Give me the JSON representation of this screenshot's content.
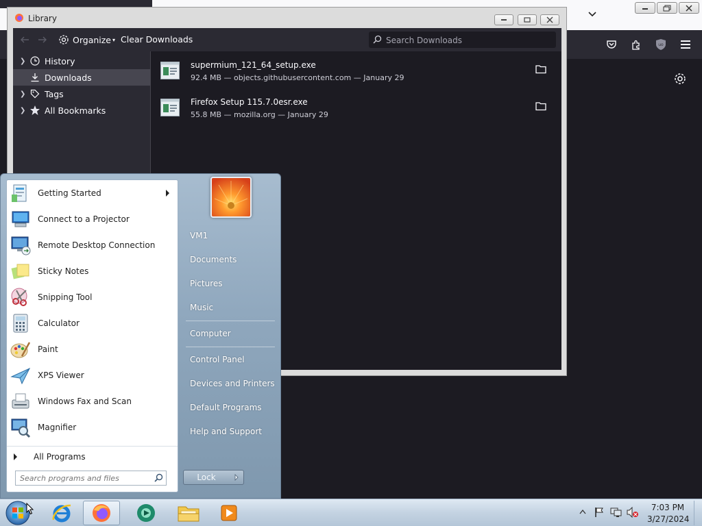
{
  "library": {
    "title": "Library",
    "toolbar": {
      "organize": "Organize",
      "clear": "Clear Downloads",
      "search_placeholder": "Search Downloads"
    },
    "sidebar": [
      {
        "label": "History",
        "icon": "clock-icon",
        "selected": false
      },
      {
        "label": "Downloads",
        "icon": "download-icon",
        "selected": true
      },
      {
        "label": "Tags",
        "icon": "tag-icon",
        "selected": false
      },
      {
        "label": "All Bookmarks",
        "icon": "star-icon",
        "selected": false
      }
    ],
    "downloads": [
      {
        "name": "supermium_121_64_setup.exe",
        "meta": "92.4 MB — objects.githubusercontent.com — January 29"
      },
      {
        "name": "Firefox Setup 115.7.0esr.exe",
        "meta": "55.8 MB — mozilla.org — January 29"
      }
    ]
  },
  "start_menu": {
    "programs": [
      {
        "label": "Getting Started",
        "icon": "getting-started-icon",
        "submenu": true
      },
      {
        "label": "Connect to a Projector",
        "icon": "projector-icon",
        "submenu": false
      },
      {
        "label": "Remote Desktop Connection",
        "icon": "remote-desktop-icon",
        "submenu": false
      },
      {
        "label": "Sticky Notes",
        "icon": "sticky-notes-icon",
        "submenu": false
      },
      {
        "label": "Snipping Tool",
        "icon": "snipping-tool-icon",
        "submenu": false
      },
      {
        "label": "Calculator",
        "icon": "calculator-icon",
        "submenu": false
      },
      {
        "label": "Paint",
        "icon": "paint-icon",
        "submenu": false
      },
      {
        "label": "XPS Viewer",
        "icon": "xps-viewer-icon",
        "submenu": false
      },
      {
        "label": "Windows Fax and Scan",
        "icon": "fax-scan-icon",
        "submenu": false
      },
      {
        "label": "Magnifier",
        "icon": "magnifier-icon",
        "submenu": false
      }
    ],
    "all_programs": "All Programs",
    "search_placeholder": "Search programs and files",
    "right": {
      "user": "VM1",
      "documents": "Documents",
      "pictures": "Pictures",
      "music": "Music",
      "computer": "Computer",
      "control_panel": "Control Panel",
      "devices": "Devices and Printers",
      "defaults": "Default Programs",
      "help": "Help and Support"
    },
    "lock": "Lock"
  },
  "taskbar": {
    "apps": [
      "start-orb-icon",
      "internet-explorer-icon",
      "firefox-icon",
      "media-center-icon",
      "explorer-folder-icon",
      "media-player-icon"
    ],
    "time": "7:03 PM",
    "date": "3/27/2024"
  },
  "colors": {
    "firefox_dark": "#1c1b22",
    "firefox_toolbar": "#2b2a33",
    "win7_taskbar": "#c4d3e2"
  }
}
